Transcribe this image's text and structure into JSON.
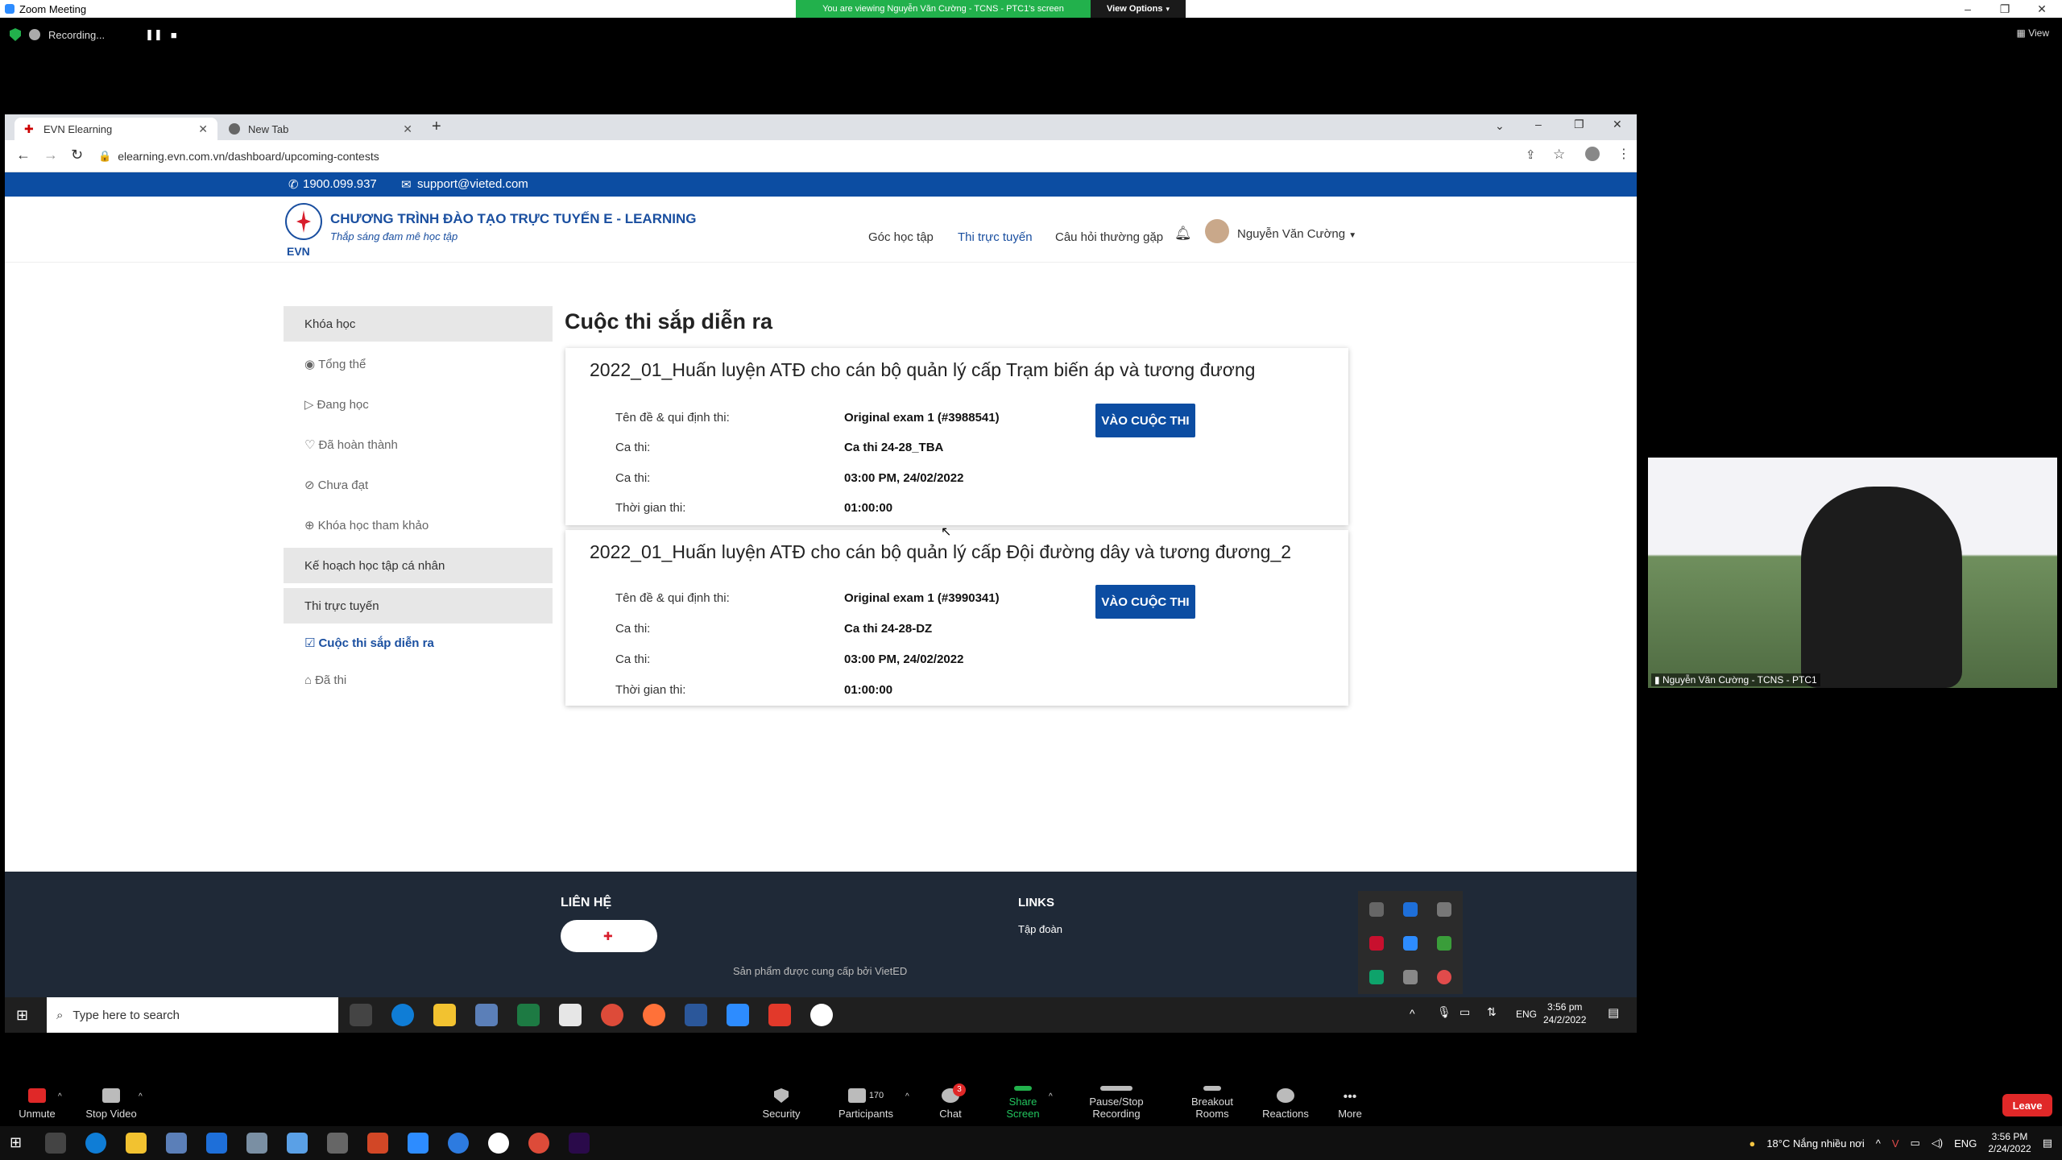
{
  "zoom": {
    "window_title": "Zoom Meeting",
    "viewing_banner": "You are viewing Nguyễn Văn Cường - TCNS - PTC1's screen",
    "view_options": "View Options",
    "recording_label": "Recording...",
    "view_label": "View",
    "toolbar": {
      "unmute": "Unmute",
      "stop_video": "Stop Video",
      "security": "Security",
      "participants": "Participants",
      "participants_count": "170",
      "chat": "Chat",
      "chat_badge": "3",
      "share_screen": "Share Screen",
      "pause_recording": "Pause/Stop Recording",
      "breakout": "Breakout Rooms",
      "reactions": "Reactions",
      "more": "More",
      "leave": "Leave"
    },
    "participant_name": "Nguyễn Văn Cường - TCNS - PTC1"
  },
  "browser": {
    "tabs": [
      {
        "label": "EVN Elearning"
      },
      {
        "label": "New Tab"
      }
    ],
    "url": "elearning.evn.com.vn/dashboard/upcoming-contests"
  },
  "site": {
    "phone": "1900.099.937",
    "email": "support@vieted.com",
    "title": "CHƯƠNG TRÌNH ĐÀO TẠO TRỰC TUYẾN E - LEARNING",
    "subtitle": "Thắp sáng đam mê học tập",
    "logo_text": "EVN",
    "nav": [
      "Góc học tập",
      "Thi trực tuyến",
      "Câu hỏi thường gặp"
    ],
    "user_name": "Nguyễn Văn Cường",
    "sidebar": {
      "group_courses": "Khóa học",
      "items": [
        "Tổng thể",
        "Đang học",
        "Đã hoàn thành",
        "Chưa đạt",
        "Khóa học tham khảo"
      ],
      "group_plan": "Kế hoạch học tập cá nhân",
      "group_exam": "Thi trực tuyến",
      "exam_items": [
        "Cuộc thi sắp diễn ra",
        "Đã thi"
      ]
    },
    "page_title": "Cuộc thi sắp diễn ra",
    "contests": [
      {
        "title": "2022_01_Huấn luyện ATĐ cho cán bộ quản lý cấp Trạm biến áp và tương đương",
        "labels": [
          "Tên đề & qui định thi:",
          "Ca thi:",
          "Ca thi:",
          "Thời gian thi:"
        ],
        "values": [
          "Original exam 1 (#3988541)",
          "Ca thi 24-28_TBA",
          "03:00 PM, 24/02/2022",
          "01:00:00"
        ],
        "button": "VÀO CUỘC THI"
      },
      {
        "title": "2022_01_Huấn luyện ATĐ cho cán bộ quản lý cấp Đội đường dây và tương đương_2",
        "labels": [
          "Tên đề & qui định thi:",
          "Ca thi:",
          "Ca thi:",
          "Thời gian thi:"
        ],
        "values": [
          "Original exam 1 (#3990341)",
          "Ca thi 24-28-DZ",
          "03:00 PM, 24/02/2022",
          "01:00:00"
        ],
        "button": "VÀO CUỘC THI"
      }
    ],
    "footer": {
      "contact": "LIÊN HỆ",
      "links": "LINKS",
      "link_item": "Tập đoàn",
      "credit": "Sản phẩm được cung cấp bởi VietED"
    }
  },
  "inner_taskbar": {
    "search_placeholder": "Type here to search",
    "lang": "ENG",
    "time": "3:56 pm",
    "date": "24/2/2022"
  },
  "outer_taskbar": {
    "weather": "18°C  Nắng nhiều nơi",
    "lang": "ENG",
    "time": "3:56 PM",
    "date": "2/24/2022"
  },
  "colors": {
    "evn_blue": "#0c4da2",
    "zoom_green": "#22b14c",
    "leave_red": "#e02828"
  }
}
